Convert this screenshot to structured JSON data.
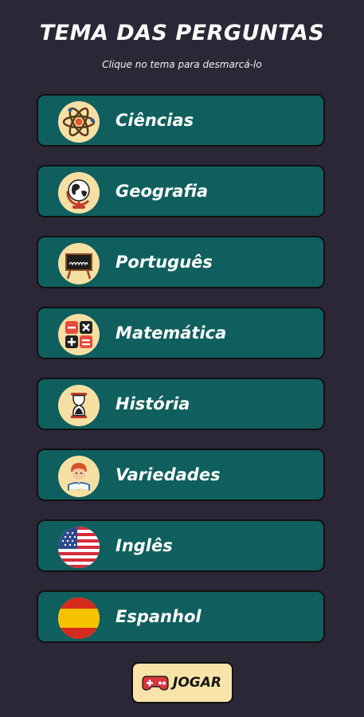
{
  "header": {
    "title": "TEMA DAS PERGUNTAS",
    "subtitle": "Clique no tema para desmarcá-lo"
  },
  "topics": [
    {
      "label": "Ciências",
      "icon": "atom-icon"
    },
    {
      "label": "Geografia",
      "icon": "globe-icon"
    },
    {
      "label": "Português",
      "icon": "chalkboard-icon"
    },
    {
      "label": "Matemática",
      "icon": "calculator-symbols-icon"
    },
    {
      "label": "História",
      "icon": "hourglass-icon"
    },
    {
      "label": "Variedades",
      "icon": "reading-boy-icon"
    },
    {
      "label": "Inglês",
      "icon": "usa-flag-icon"
    },
    {
      "label": "Espanhol",
      "icon": "spain-flag-icon"
    }
  ],
  "play_button": {
    "label": "JOGAR",
    "icon": "gamepad-icon"
  },
  "colors": {
    "background": "#2b2737",
    "topic_fill": "#0f5f5e",
    "icon_circle": "#f6dfa3",
    "play_fill": "#f8e3a8"
  }
}
